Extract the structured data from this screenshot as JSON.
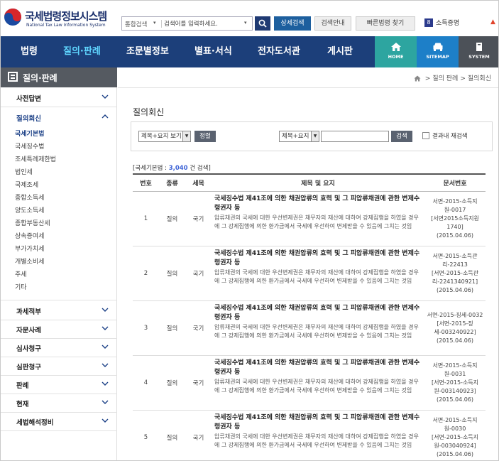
{
  "header": {
    "logo_title": "국세법령정보시스템",
    "logo_sub": "National Tax Law Information System",
    "search_type": "통합검색",
    "search_placeholder": "검색어를 입력하세요.",
    "btn_advanced": "상세검색",
    "btn_guide": "검색안내",
    "btn_find_law": "빠른법령 찾기",
    "cert_badge": "8",
    "cert_label": "소득증명"
  },
  "gnb": {
    "items": [
      "법령",
      "질의·판례",
      "조문별정보",
      "별표·서식",
      "전자도서관",
      "게시판"
    ],
    "quick": [
      "HOME",
      "SITEMAP",
      "SYSTEM"
    ]
  },
  "sidebar": {
    "title": "질의·판례",
    "sections": [
      "사전답변",
      "질의회신",
      "과세적부",
      "자문사례",
      "심사청구",
      "심판청구",
      "판례",
      "현재",
      "세법해석정비"
    ],
    "sub_items": [
      "국세기본법",
      "국세징수법",
      "조세특례제한법",
      "법인세",
      "국제조세",
      "종합소득세",
      "양도소득세",
      "종합부동산세",
      "상속증여세",
      "부가가치세",
      "개별소비세",
      "주세",
      "기타"
    ]
  },
  "breadcrumb": {
    "items": [
      "질의 판례",
      "질의회신"
    ]
  },
  "main": {
    "title": "질의회신",
    "filter": {
      "select1": "제목+요지 보기",
      "btn1": "정렬",
      "select2": "제목+요지",
      "btn2": "검색",
      "check_label": "결과내 재검색"
    },
    "result": {
      "prefix": "[국세기본법 :",
      "count": "3,040",
      "suffix": "건 검색]"
    },
    "table": {
      "headers": [
        "번호",
        "종류",
        "세목",
        "제목 및 요지",
        "문서번호"
      ],
      "rows": [
        {
          "no": "1",
          "kind": "질의",
          "tax": "국기",
          "title": "국세징수법 제41조에 의한 채권압류의 효력 및 그 피압류채권에 관한 변제수령권자 등",
          "summary": "압류채권의 국세에 대한 우선변제권은 채무자의 재산에 대하여 강제집행을 하였을 경우에 그 강제집행에 의한 환가금에서 국세에 우선하여 변제받을 수 있음에 그치는 것임",
          "doc": [
            "서면-2015-소득지원-0017",
            "[서면2015소득지원1740]",
            "(2015.04.06)"
          ]
        },
        {
          "no": "2",
          "kind": "질의",
          "tax": "국기",
          "title": "국세징수법 제41조에 의한 채권압류의 효력 및 그 피압류채권에 관한 변제수령권자 등",
          "summary": "압류채권의 국세에 대한 우선변제권은 채무자의 재산에 대하여 강제집행을 하였을 경우에 그 강제집행에 의한 환가금에서 국세에 우선하여 변제받을 수 있음에 그치는 것임",
          "doc": [
            "서면-2015-소득관리-22413",
            "[서면-2015-소득관리-2241340921]",
            "(2015.04.06)"
          ]
        },
        {
          "no": "3",
          "kind": "질의",
          "tax": "국기",
          "title": "국세징수법 제41조에 의한 채권압류의 효력 및 그 피압류채권에 관한 변제수령권자 등",
          "summary": "압류채권의 국세에 대한 우선변제권은 채무자의 재산에 대하여 강제집행을 하였을 경우에 그 강제집행에 의한 환가금에서 국세에 우선하여 변제받을 수 있음에 그치는 것임",
          "doc": [
            "서면-2015-징세-0032",
            "[서면-2015-징세-003240922]",
            "(2015.04.06)"
          ]
        },
        {
          "no": "4",
          "kind": "질의",
          "tax": "국기",
          "title": "국세징수법 제41조에 의한 채권압류의 효력 및 그 피압류채권에 관한 변제수령권자 등",
          "summary": "압류채권의 국세에 대한 우선변제권은 채무자의 재산에 대하여 강제집행을 하였을 경우에 그 강제집행에 의한 환가금에서 국세에 우선하여 변제받을 수 있음에 그치는 것임",
          "doc": [
            "서면-2015-소득지원-0031",
            "[서면-2015-소득지원-003140923]",
            "(2015.04.06)"
          ]
        },
        {
          "no": "5",
          "kind": "질의",
          "tax": "국기",
          "title": "국세징수법 제41조에 의한 채권압류의 효력 및 그 피압류채권에 관한 변제수령권자 등",
          "summary": "압류채권의 국세에 대한 우선변제권은 채무자의 재산에 대하여 강제집행을 하였을 경우에 그 강제집행에 의한 환가금에서 국세에 우선하여 변제받을 수 있음에 그치는 것임",
          "doc": [
            "서면-2015-소득지원-0030",
            "[서면-2015-소득지원-003040924]",
            "(2015.04.06)"
          ]
        }
      ]
    }
  },
  "colors": {
    "gnb_bg": "#1c3f7a",
    "gnb_active": "#5fd6ff",
    "accent": "#1d5f9e",
    "home_tile": "#2da5a0",
    "sitemap_tile": "#1d7fc8",
    "system_tile": "#4c5158"
  }
}
